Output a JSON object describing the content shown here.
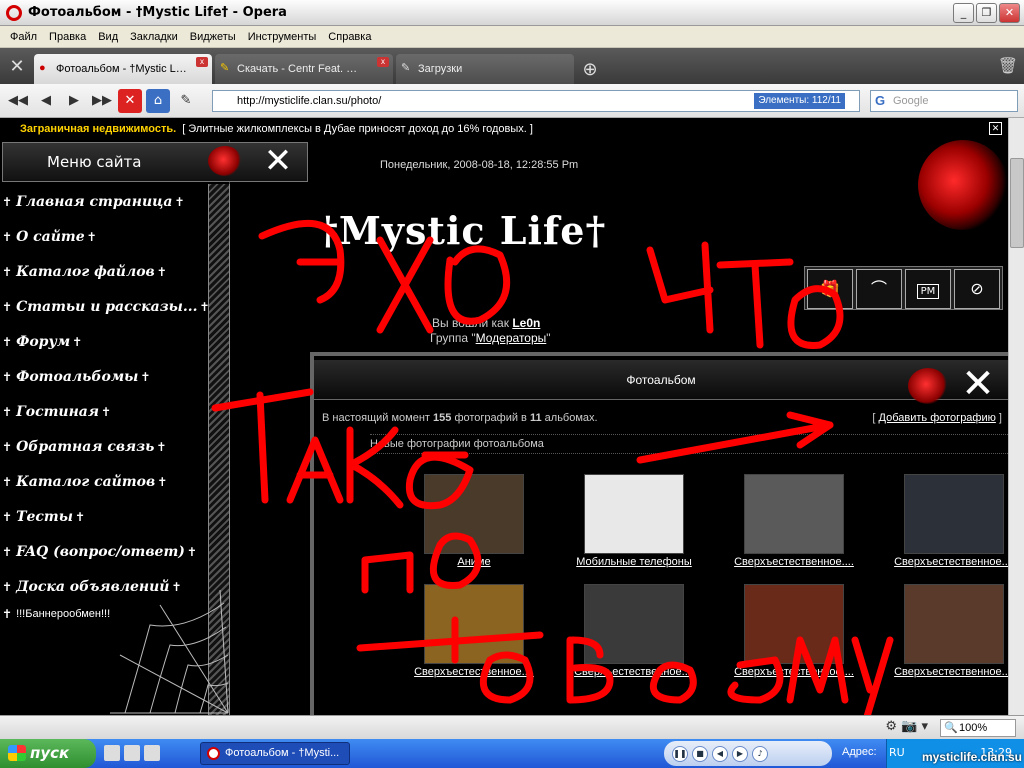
{
  "window": {
    "title": "Фотоальбом - †Mystic Life† - Opera"
  },
  "menubar": [
    "Файл",
    "Правка",
    "Вид",
    "Закладки",
    "Виджеты",
    "Инструменты",
    "Справка"
  ],
  "tabs": [
    {
      "label": "Фотоальбом - †Mystic L…",
      "active": true
    },
    {
      "label": "Скачать - Centr Feat. …",
      "active": false
    },
    {
      "label": "Загрузки",
      "active": false
    }
  ],
  "address": {
    "url": "http://mysticlife.clan.su/photo/",
    "elements": "Элементы:  112/11",
    "search_placeholder": "Google"
  },
  "ad": {
    "title": "Заграничная недвижимость.",
    "text": "[ Элитные жилкомплексы в Дубае приносят доход до 16% годовых. ]"
  },
  "site": {
    "menu_header": "Меню сайта",
    "datetime": "Понедельник, 2008-08-18, 12:28:55 Pm",
    "logo": "†Mystic Life†",
    "login_prefix": "Вы вошли как",
    "login_user": "Le0n",
    "group_prefix": "Группа \"",
    "group_name": "Модераторы",
    "group_suffix": "\"",
    "toolbar_icons": [
      "gift-icon",
      "bat-icon",
      "pm-icon",
      "block-icon"
    ],
    "pm_label": "PM"
  },
  "sidebar": {
    "items": [
      {
        "label": "Главная страница"
      },
      {
        "label": "О сайте"
      },
      {
        "label": "Каталог файлов"
      },
      {
        "label": "Статьи и рассказы..."
      },
      {
        "label": "Форум"
      },
      {
        "label": "Фотоальбомы"
      },
      {
        "label": "Гостиная"
      },
      {
        "label": "Обратная связь"
      },
      {
        "label": "Каталог сайтов"
      },
      {
        "label": "Тесты"
      },
      {
        "label": "FAQ (вопрос/ответ)"
      },
      {
        "label": "Доска объявлений"
      }
    ],
    "banner": "!!!Баннерообмен!!!"
  },
  "album": {
    "header": "Фотоальбом",
    "stats_prefix": "В настоящий момент",
    "photos_count": "155",
    "stats_mid": "фотографий в",
    "albums_count": "11",
    "stats_suffix": "альбомах.",
    "add_photo": "Добавить фотографию",
    "new_photos": "Новые фотографии фотоальбома",
    "thumbs": [
      {
        "caption": "Аниме",
        "color": "#4a3a2a"
      },
      {
        "caption": "Мобильные телефоны",
        "color": "#e8e8e8"
      },
      {
        "caption": "Сверхъестественное....",
        "color": "#5a5a5a"
      },
      {
        "caption": "Сверхъестественное....",
        "color": "#2c3038"
      },
      {
        "caption": "Сверхъестественное....",
        "color": "#8a6420"
      },
      {
        "caption": "Сверхъестественное....",
        "color": "#3a3a3a"
      },
      {
        "caption": "Сверхъестественное....",
        "color": "#6a2a1a"
      },
      {
        "caption": "Сверхъестественное....",
        "color": "#5a3a2a"
      }
    ]
  },
  "scribble_text": [
    "Это что",
    "такое",
    "по",
    "твоему"
  ],
  "statusbar": {
    "zoom": "100%"
  },
  "taskbar": {
    "start": "пуск",
    "task": "Фотоальбом - †Mysti...",
    "address_label": "Адрес:",
    "lang": "RU",
    "time": "13:29",
    "watermark": "mysticlife.clan.su"
  }
}
